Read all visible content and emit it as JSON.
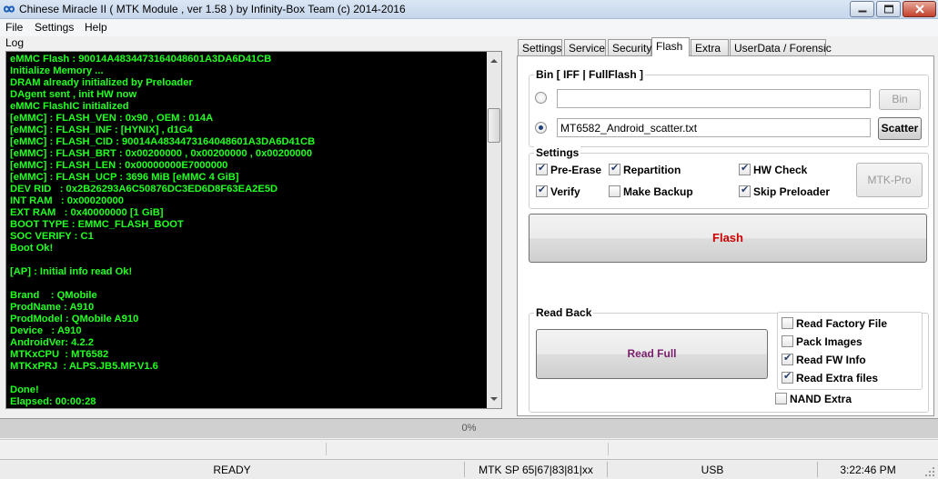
{
  "window": {
    "title": "Chinese Miracle II ( MTK Module , ver 1.58 ) by Infinity-Box Team (c) 2014-2016",
    "icon": "infinity-logo-icon"
  },
  "menu": [
    "File",
    "Settings",
    "Help"
  ],
  "log": {
    "label": "Log",
    "lines": [
      "eMMC Flash : 90014A4834473164048601A3DA6D41CB",
      "Initialize Memory ...",
      "DRAM already initialized by Preloader",
      "DAgent sent , init HW now",
      "eMMC FlashIC initialized",
      "[eMMC] : FLASH_VEN : 0x90 , OEM : 014A",
      "[eMMC] : FLASH_INF : [HYNIX] , d1G4",
      "[eMMC] : FLASH_CID : 90014A4834473164048601A3DA6D41CB",
      "[eMMC] : FLASH_BRT : 0x00200000 , 0x00200000 , 0x00200000",
      "[eMMC] : FLASH_LEN : 0x00000000E7000000",
      "[eMMC] : FLASH_UCP : 3696 MiB [eMMC 4 GiB]",
      "DEV RID   : 0x2B26293A6C50876DC3ED6D8F63EA2E5D",
      "INT RAM   : 0x00020000",
      "EXT RAM   : 0x40000000 [1 GiB]",
      "BOOT TYPE : EMMC_FLASH_BOOT",
      "SOC VERIFY : C1",
      "Boot Ok!",
      "",
      "[AP] : Initial info read Ok!",
      "",
      "Brand    : QMobile",
      "ProdName : A910",
      "ProdModel : QMobile A910",
      "Device   : A910",
      "AndroidVer: 4.2.2",
      "MTKxCPU  : MT6582",
      "MTKxPRJ  : ALPS.JB5.MP.V1.6",
      "",
      "Done!",
      "Elapsed: 00:00:28"
    ],
    "text_color": "#22ff22"
  },
  "tabs": [
    "Settings",
    "Service",
    "Security",
    "Flash",
    "Extra",
    "UserData / Forensic"
  ],
  "active_tab": "Flash",
  "bin_group": {
    "title": "Bin  [ IFF | FullFlash ]",
    "bin_path": "",
    "bin_button": "Bin",
    "scatter_path": "MT6582_Android_scatter.txt",
    "scatter_button": "Scatter"
  },
  "settings_group": {
    "title": "Settings",
    "options": [
      {
        "label": "Pre-Erase",
        "checked": true
      },
      {
        "label": "Repartition",
        "checked": true
      },
      {
        "label": "HW Check",
        "checked": true
      },
      {
        "label": "Verify",
        "checked": true
      },
      {
        "label": "Make Backup",
        "checked": false
      },
      {
        "label": "Skip Preloader",
        "checked": true
      }
    ],
    "mtk_pro_button": "MTK-Pro"
  },
  "flash_button": {
    "label": "Flash",
    "color": "#cc0000"
  },
  "readback_group": {
    "title": "Read Back",
    "read_full_button": {
      "label": "Read Full",
      "color": "#7a1f6e"
    },
    "options": [
      {
        "label": "Read Factory File",
        "checked": false
      },
      {
        "label": "Pack Images",
        "checked": false
      },
      {
        "label": "Read FW Info",
        "checked": true
      },
      {
        "label": "Read Extra files",
        "checked": true
      }
    ],
    "nand_extra": {
      "label": "NAND Extra",
      "checked": false
    }
  },
  "progress": {
    "percent": 0,
    "text": "0%"
  },
  "status": {
    "state": "READY",
    "mode": "MTK SP 65|67|83|81|xx",
    "port": "USB",
    "time": "3:22:46 PM"
  }
}
